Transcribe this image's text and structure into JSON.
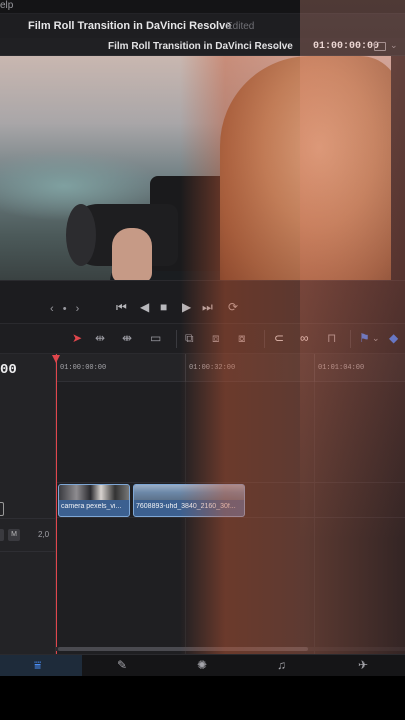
{
  "menu": {
    "fragment": "elp"
  },
  "project": {
    "title": "Film Roll Transition in DaVinci Resolve",
    "status": "Edited"
  },
  "viewer": {
    "title": "Film Roll Transition in DaVinci Resolve",
    "dropdown_icon": "chevron-down-icon",
    "timecode": "01:00:00:00"
  },
  "transport": {
    "jog": "‹ • ›",
    "buttons": [
      "skip-back-icon",
      "step-back-icon",
      "stop-icon",
      "play-icon",
      "skip-forward-icon",
      "loop-icon"
    ]
  },
  "toolbar": {
    "tools": [
      "selection-icon",
      "trim-icon",
      "dynamic-trim-icon",
      "blade-icon",
      "insert-icon",
      "overwrite-icon",
      "replace-icon",
      "snap-icon",
      "link-icon",
      "lock-icon",
      "flag-icon",
      "marker-icon"
    ],
    "colors": {
      "selection": "#e0464c",
      "flag": "#3d7ff5"
    }
  },
  "timeline": {
    "current_timecode": "00",
    "ruler": [
      "01:00:00:00",
      "01:00:32:00",
      "01:01:04:00"
    ],
    "clips": [
      {
        "name": "camera pexels_vi..."
      },
      {
        "name": "7608893-uhd_3840_2160_30f..."
      }
    ],
    "audio_track": {
      "mute": "M",
      "level": "2,0"
    }
  },
  "pagenav": {
    "pages": [
      "cut-icon",
      "edit-icon",
      "fusion-icon",
      "color-icon",
      "fairlight-icon",
      "deliver-icon"
    ],
    "active": "edit",
    "accent": "#4a8ef6"
  }
}
